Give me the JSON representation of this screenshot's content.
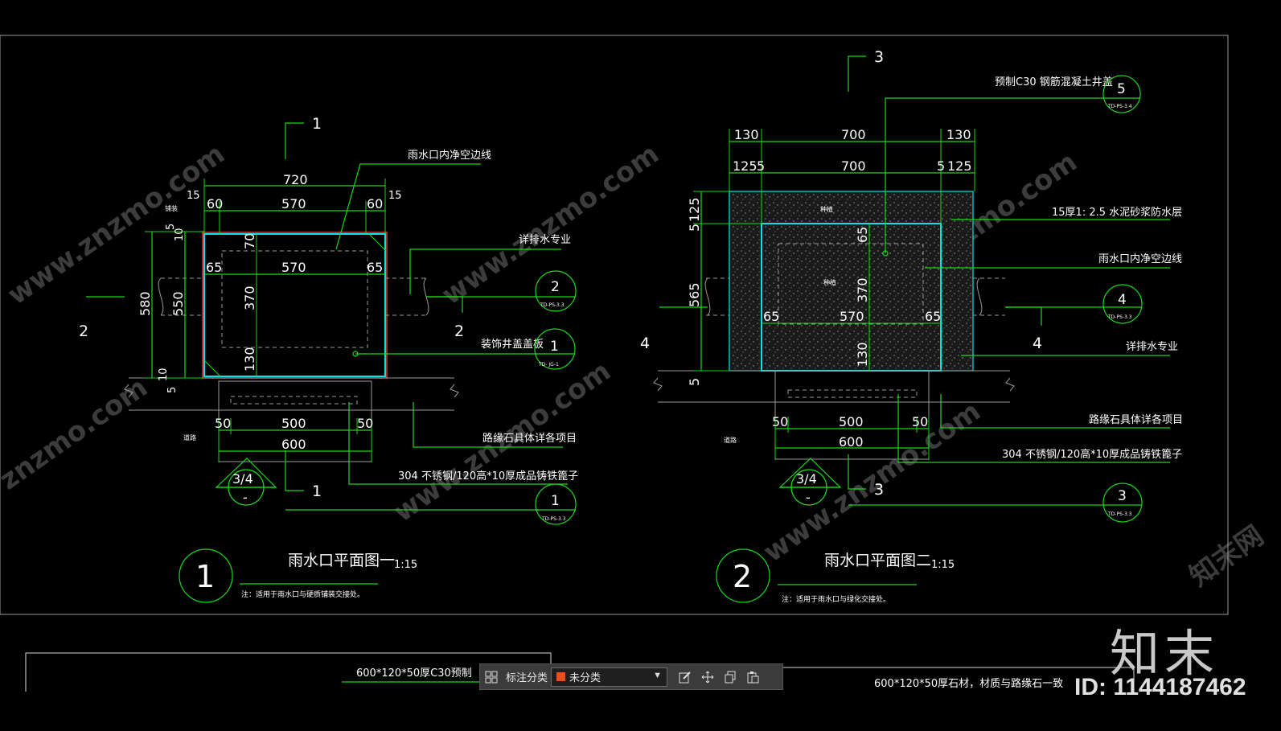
{
  "drawing1": {
    "title": "雨水口平面图一",
    "scale": "1:15",
    "circle_num": "1",
    "note": "注：适用于雨水口与硬质铺装交接处。",
    "labels": {
      "clear_line": "雨水口内净空边线",
      "drainage": "详排水专业",
      "cover": "装饰井盖盖板",
      "curb": "路缘石具体详各项目",
      "grate": "304 不锈钢/120高*10厚成品铸铁篦子",
      "paving": "铺装",
      "road": "道路"
    },
    "dims": {
      "top_total": "720",
      "top_15a": "15",
      "top_15b": "15",
      "top_60a": "60",
      "top_570": "570",
      "top_60b": "60",
      "inner_65a": "65",
      "inner_570": "570",
      "inner_65b": "65",
      "v_70": "70",
      "v_370": "370",
      "v_130": "130",
      "v_580": "580",
      "v_550": "550",
      "v_10a": "10",
      "v_5a": "5",
      "v_10b": "10",
      "v_5b": "5",
      "bot_50a": "50",
      "bot_500": "500",
      "bot_50b": "50",
      "bot_600": "600"
    },
    "section_marks": {
      "top": "1",
      "bottom": "1",
      "left": "2",
      "right": "2"
    },
    "triangle": {
      "top": "3/4",
      "bottom": "-"
    },
    "callouts": [
      {
        "num": "2",
        "ref": "TD-PS-3.3"
      },
      {
        "num": "1",
        "ref": "TD- JG-1"
      },
      {
        "num": "1",
        "ref": "TD-PS-3.3"
      }
    ]
  },
  "drawing2": {
    "title": "雨水口平面图二",
    "scale": "1:15",
    "circle_num": "2",
    "note": "注：适用于雨水口与绿化交接处。",
    "labels": {
      "precast": "预制C30 钢筋混凝土井盖",
      "mortar": "15厚1: 2.5 水泥砂浆防水层",
      "clear_line": "雨水口内净空边线",
      "drainage": "详排水专业",
      "curb": "路缘石具体详各项目",
      "grate": "304 不锈钢/120高*10厚成品铸铁篦子",
      "planting": "种植",
      "planting2": "种植",
      "road": "道路"
    },
    "dims": {
      "top_130a": "130",
      "top_700": "700",
      "top_130b": "130",
      "row2_125a": "125",
      "row2_5a": "5",
      "row2_700": "700",
      "row2_5b": "5",
      "row2_125b": "125",
      "v_125": "125",
      "v_5": "5",
      "v_565": "565",
      "v_5b": "5",
      "v_65": "65",
      "v_370": "370",
      "v_130": "130",
      "inner_65a": "65",
      "inner_570": "570",
      "inner_65b": "65",
      "bot_50a": "50",
      "bot_500": "500",
      "bot_50b": "50",
      "bot_600": "600"
    },
    "section_marks": {
      "top": "3",
      "bottom": "3",
      "left": "4",
      "right": "4"
    },
    "triangle": {
      "top": "3/4",
      "bottom": "-"
    },
    "callouts": [
      {
        "num": "5",
        "ref": "TD-PS-3.4"
      },
      {
        "num": "4",
        "ref": "TD-PS-3.3"
      },
      {
        "num": "3",
        "ref": "TD-PS-3.3"
      }
    ]
  },
  "bottom_labels": {
    "left": "600*120*50厚C30预制",
    "right": "600*120*50厚石材，材质与路缘石一致"
  },
  "watermark": {
    "site": "znzmo.com",
    "site2": "www.znzmo.com",
    "cn": "知末网",
    "brand": "知末",
    "id": "ID: 1144187462"
  },
  "toolbar": {
    "label": "标注分类",
    "selected": "未分类",
    "swatch_color": "#e0531c",
    "icons": [
      "grid-icon",
      "edit-icon",
      "move-icon",
      "copy-icon",
      "paste-icon"
    ]
  }
}
